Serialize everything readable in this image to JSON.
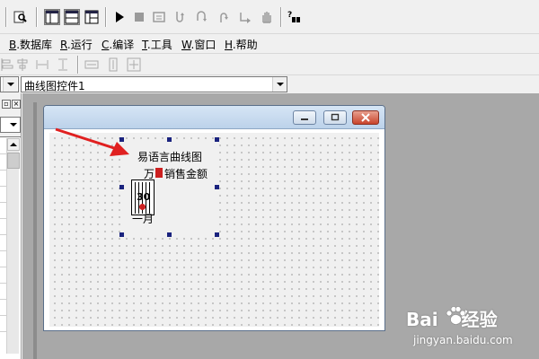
{
  "menu": {
    "items": [
      {
        "key": "B",
        "label": ".数据库"
      },
      {
        "key": "R",
        "label": ".运行"
      },
      {
        "key": "C",
        "label": ".编译"
      },
      {
        "key": "T",
        "label": ".工具"
      },
      {
        "key": "W",
        "label": ".窗口"
      },
      {
        "key": "H",
        "label": ".帮助"
      }
    ]
  },
  "toolbar": {
    "buttons": [
      "find-icon",
      "layout-1-icon",
      "layout-2-icon",
      "layout-3-icon",
      "run-icon",
      "stop-icon",
      "compile-icon",
      "step-into-icon",
      "step-over-icon",
      "step-out-icon",
      "run-to-cursor-icon",
      "breakpoint-hand-icon",
      "help-icon"
    ]
  },
  "component_selector": {
    "selected": "曲线图控件1"
  },
  "designer": {
    "chart_control": {
      "title": "易语言曲线图",
      "legend_left": "万",
      "legend_series": "销售金额",
      "y_tick": "30",
      "x_label": "一月"
    }
  },
  "watermark": {
    "line1_left": "Bai",
    "line1_right": "经验",
    "line2": "jingyan.baidu.com"
  },
  "colors": {
    "title_bar": "#c5d9ef",
    "close_button": "#c9442b",
    "series_red": "#cc2020",
    "arrow_red": "#e02020",
    "selection_handle": "#1a237e"
  }
}
